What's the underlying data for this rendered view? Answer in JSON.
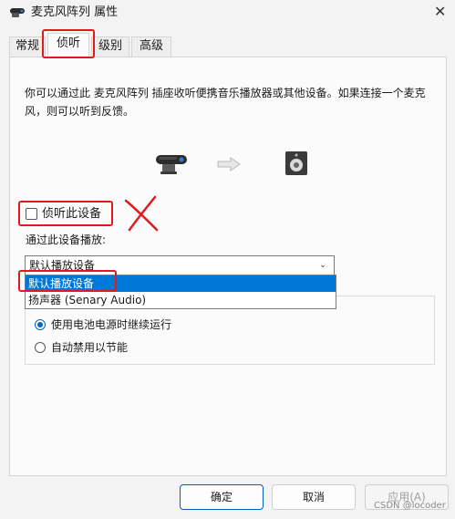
{
  "window": {
    "title": "麦克风阵列 属性",
    "close_glyph": "✕"
  },
  "tabs": [
    {
      "label": "常规"
    },
    {
      "label": "侦听",
      "active": true
    },
    {
      "label": "级别"
    },
    {
      "label": "高级"
    }
  ],
  "listen": {
    "description": "你可以通过此 麦克风阵列 插座收听便携音乐播放器或其他设备。如果连接一个麦克风，则可以听到反馈。",
    "checkbox_label": "侦听此设备",
    "checkbox_checked": false,
    "playback_label": "通过此设备播放:",
    "dropdown": {
      "selected": "默认播放设备",
      "options": [
        "默认播放设备",
        "扬声器 (Senary Audio)"
      ]
    },
    "power": {
      "option_continue": "使用电池电源时继续运行",
      "option_autodisable": "自动禁用以节能",
      "selected": "option_continue"
    }
  },
  "buttons": {
    "ok": "确定",
    "cancel": "取消",
    "apply": "应用(A)"
  },
  "watermark": "CSDN @locoder",
  "colors": {
    "accent": "#0078d7",
    "annotation": "#e01b1b"
  }
}
